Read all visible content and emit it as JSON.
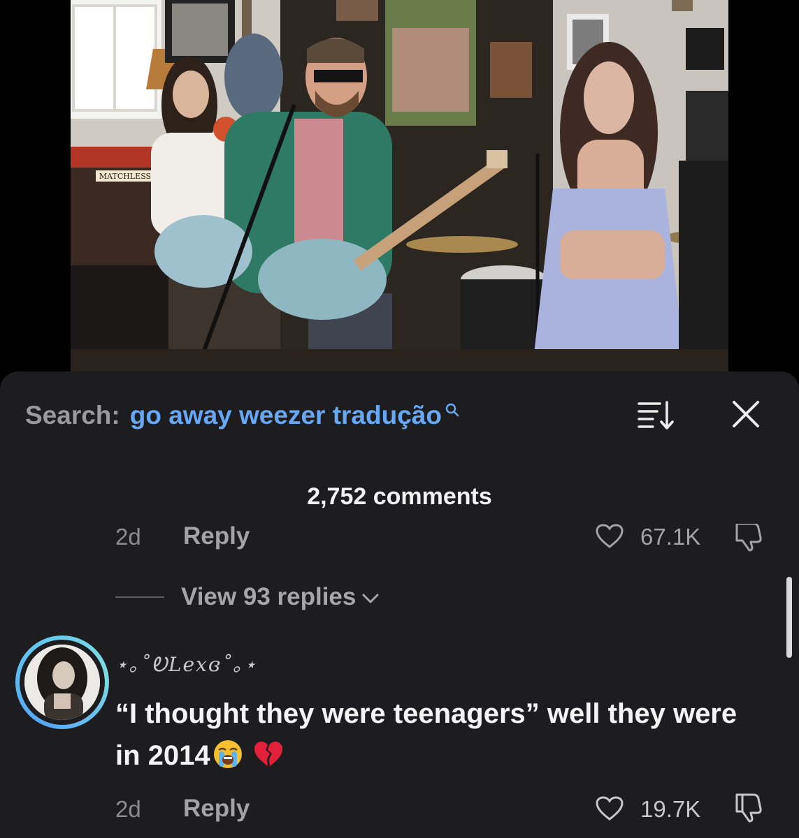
{
  "video": {
    "amp_brand": "MATCHLESS"
  },
  "search": {
    "label": "Search:",
    "query": "go away weezer tradução"
  },
  "comments": {
    "count_label": "2,752 comments",
    "previous": {
      "time": "2d",
      "reply_label": "Reply",
      "likes": "67.1K",
      "view_replies": "View 93 replies"
    },
    "current": {
      "username": "⋆｡˚ᎧLexɞ˚｡⋆",
      "text": "“I thought they were teenagers” well they were in 2014",
      "emojis": [
        "loudly-crying-face",
        "broken-heart"
      ],
      "time": "2d",
      "reply_label": "Reply",
      "likes": "19.7K"
    }
  },
  "colors": {
    "sheet_bg": "#1d1d1f",
    "query_blue": "#67a8f4",
    "avatar_ring": "#56a6f6"
  }
}
